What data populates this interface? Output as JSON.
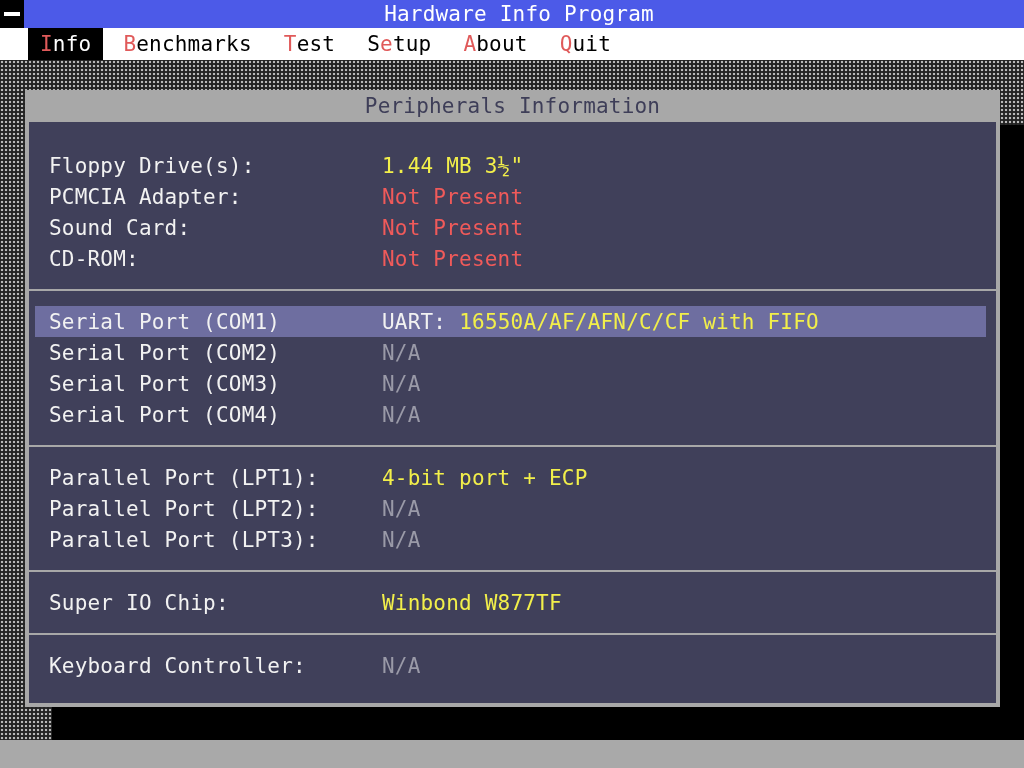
{
  "window": {
    "title": "Hardware Info Program"
  },
  "menu": [
    {
      "hotkey": "I",
      "after": "nfo",
      "selected": true
    },
    {
      "hotkey": "B",
      "after": "enchmarks",
      "selected": false
    },
    {
      "hotkey": "T",
      "after": "est",
      "selected": false
    },
    {
      "before": "S",
      "hotkey": "e",
      "after": "tup",
      "selected": false
    },
    {
      "hotkey": "A",
      "after": "bout",
      "selected": false
    },
    {
      "hotkey": "Q",
      "after": "uit",
      "selected": false
    }
  ],
  "dialog": {
    "title": "Peripherals Information",
    "sections": [
      {
        "rows": [
          {
            "label": "Floppy Drive(s):",
            "value": "1.44 MB 3½\"",
            "color": "#f2ef4a",
            "selected": false
          },
          {
            "label": "PCMCIA Adapter:",
            "value": "Not Present",
            "color": "#f05a5a",
            "selected": false
          },
          {
            "label": "Sound Card:",
            "value": "Not Present",
            "color": "#f05a5a",
            "selected": false
          },
          {
            "label": "CD-ROM:",
            "value": "Not Present",
            "color": "#f05a5a",
            "selected": false
          }
        ]
      },
      {
        "rows": [
          {
            "label": "Serial Port (COM1)",
            "prefix": "UART:",
            "value": "16550A/AF/AFN/C/CF with FIFO",
            "color": "#f2ef4a",
            "selected": true
          },
          {
            "label": "Serial Port (COM2)",
            "value": "N/A",
            "color": "#9a9aa8",
            "selected": false
          },
          {
            "label": "Serial Port (COM3)",
            "value": "N/A",
            "color": "#9a9aa8",
            "selected": false
          },
          {
            "label": "Serial Port (COM4)",
            "value": "N/A",
            "color": "#9a9aa8",
            "selected": false
          }
        ]
      },
      {
        "rows": [
          {
            "label": "Parallel Port (LPT1):",
            "value": "4-bit port + ECP",
            "color": "#f2ef4a",
            "selected": false
          },
          {
            "label": "Parallel Port (LPT2):",
            "value": "N/A",
            "color": "#9a9aa8",
            "selected": false
          },
          {
            "label": "Parallel Port (LPT3):",
            "value": "N/A",
            "color": "#9a9aa8",
            "selected": false
          }
        ]
      },
      {
        "rows": [
          {
            "label": "Super IO Chip:",
            "value": "Winbond W877TF",
            "color": "#f2ef4a",
            "selected": false
          }
        ]
      },
      {
        "rows": [
          {
            "label": "Keyboard Controller:",
            "value": "N/A",
            "color": "#9a9aa8",
            "selected": false
          }
        ]
      }
    ]
  }
}
